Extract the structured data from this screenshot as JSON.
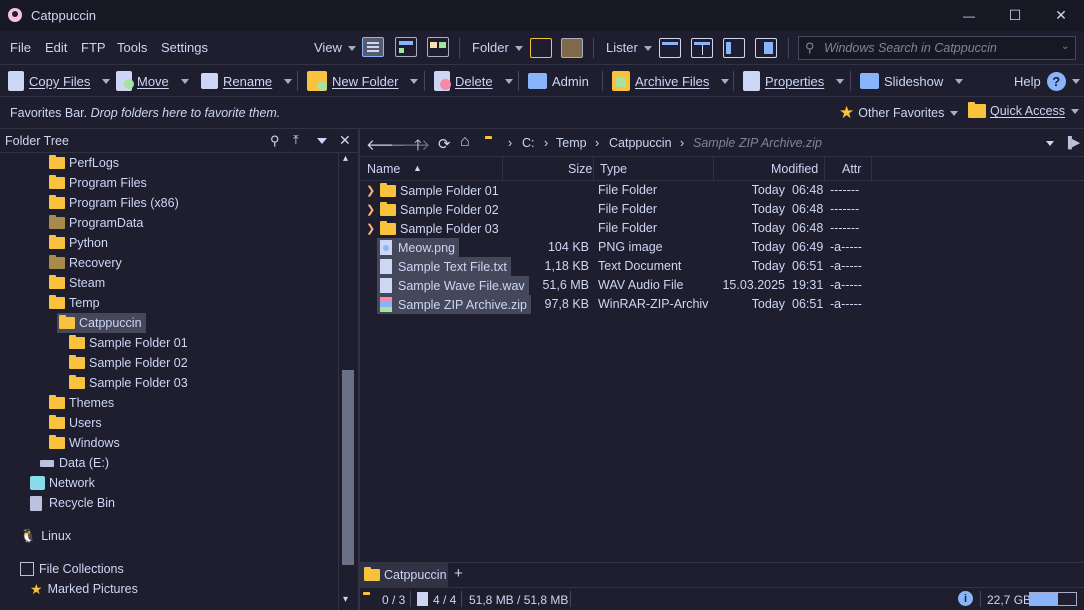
{
  "window": {
    "title": "Catppuccin",
    "minimize_glyph": "—",
    "maximize_glyph": "☐",
    "close_glyph": "✕"
  },
  "menu": {
    "file": "File",
    "edit": "Edit",
    "ftp": "FTP",
    "tools": "Tools",
    "settings": "Settings",
    "view": "View",
    "folder": "Folder",
    "lister": "Lister",
    "search_placeholder": "Windows Search in Catppuccin"
  },
  "toolbar": {
    "copy_files": "Copy Files",
    "move": "Move",
    "rename": "Rename",
    "new_folder": "New Folder",
    "delete": "Delete",
    "admin": "Admin",
    "archive_files": "Archive Files",
    "properties": "Properties",
    "slideshow": "Slideshow",
    "help": "Help"
  },
  "favbar": {
    "title": "Favorites Bar.",
    "hint": "Drop folders here to favorite them.",
    "other_favorites": "Other Favorites",
    "quick_access": "Quick Access"
  },
  "tree": {
    "header": "Folder Tree",
    "nodes": [
      {
        "label": "PerfLogs"
      },
      {
        "label": "Program Files"
      },
      {
        "label": "Program Files (x86)"
      },
      {
        "label": "ProgramData"
      },
      {
        "label": "Python"
      },
      {
        "label": "Recovery"
      },
      {
        "label": "Steam"
      },
      {
        "label": "Temp"
      },
      {
        "label": "Catppuccin"
      },
      {
        "label": "Sample Folder 01"
      },
      {
        "label": "Sample Folder 02"
      },
      {
        "label": "Sample Folder 03"
      },
      {
        "label": "Themes"
      },
      {
        "label": "Users"
      },
      {
        "label": "Windows"
      },
      {
        "label": "Data (E:)"
      },
      {
        "label": "Network"
      },
      {
        "label": "Recycle Bin"
      },
      {
        "label": "Linux"
      },
      {
        "label": "File Collections"
      },
      {
        "label": "Marked Pictures"
      }
    ]
  },
  "address": {
    "crumbs": [
      "C:",
      "Temp",
      "Catppuccin"
    ],
    "current": "Sample ZIP Archive.zip"
  },
  "columns": {
    "name": "Name",
    "size": "Size",
    "type": "Type",
    "modified": "Modified",
    "attr": "Attr"
  },
  "files": [
    {
      "name": "Sample Folder 01",
      "size": "",
      "type": "File Folder",
      "date": "Today",
      "time": "06:48",
      "attr": "-------"
    },
    {
      "name": "Sample Folder 02",
      "size": "",
      "type": "File Folder",
      "date": "Today",
      "time": "06:48",
      "attr": "-------"
    },
    {
      "name": "Sample Folder 03",
      "size": "",
      "type": "File Folder",
      "date": "Today",
      "time": "06:48",
      "attr": "-------"
    },
    {
      "name": "Meow.png",
      "size": "104 KB",
      "type": "PNG image",
      "date": "Today",
      "time": "06:49",
      "attr": "-a-----"
    },
    {
      "name": "Sample Text File.txt",
      "size": "1,18 KB",
      "type": "Text Document",
      "date": "Today",
      "time": "06:51",
      "attr": "-a-----"
    },
    {
      "name": "Sample Wave File.wav",
      "size": "51,6 MB",
      "type": "WAV Audio File",
      "date": "15.03.2025",
      "time": "19:31",
      "attr": "-a-----"
    },
    {
      "name": "Sample ZIP Archive.zip",
      "size": "97,8 KB",
      "type": "WinRAR-ZIP-Archiv",
      "date": "Today",
      "time": "06:51",
      "attr": "-a-----"
    }
  ],
  "tabs": {
    "active": "Catppuccin",
    "add": "+"
  },
  "status": {
    "folders": "0 / 3",
    "files": "4 / 4",
    "size": "51,8 MB / 51,8 MB",
    "free": "22,7 GB",
    "free_fraction": 0.6
  },
  "colors": {
    "background": "#1e1e2e",
    "folder": "#f9c23c",
    "accent": "#89b4fa",
    "selection": "#45475a"
  }
}
